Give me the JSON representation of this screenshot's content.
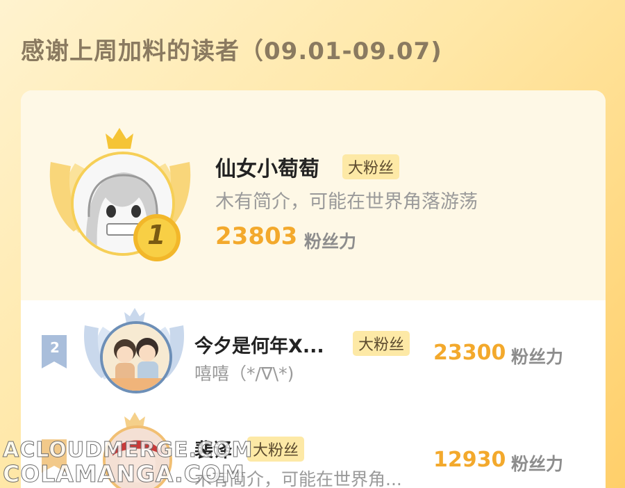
{
  "header": {
    "title": "感谢上周加料的读者（09.01-09.07)"
  },
  "entries": [
    {
      "rank": "1",
      "name": "仙女小萄萄",
      "badge": "大粉丝",
      "bio": "木有简介，可能在世界角落游荡",
      "score": "23803",
      "score_unit": "粉丝力"
    },
    {
      "rank": "2",
      "name": "今夕是何年X...",
      "badge": "大粉丝",
      "bio": "嘻嘻（*/∇\\*)",
      "score": "23300",
      "score_unit": "粉丝力"
    },
    {
      "rank": "3",
      "name": "裴译",
      "badge": "大粉丝",
      "bio": "木有简介，可能在世界角...",
      "score": "12930",
      "score_unit": "粉丝力"
    }
  ],
  "watermark": {
    "line1": "ACLOUDMERGE.COM",
    "line2": "COLAMANGA.COM"
  },
  "colors": {
    "accent": "#f3a92c",
    "gold": "#f6cf57",
    "badge_bg": "#fde9a6",
    "silver_ring": "#6d8fb7"
  },
  "icons": [
    "crown-icon",
    "wings-icon",
    "rank-1-medal-icon",
    "rank-2-flag-icon"
  ]
}
